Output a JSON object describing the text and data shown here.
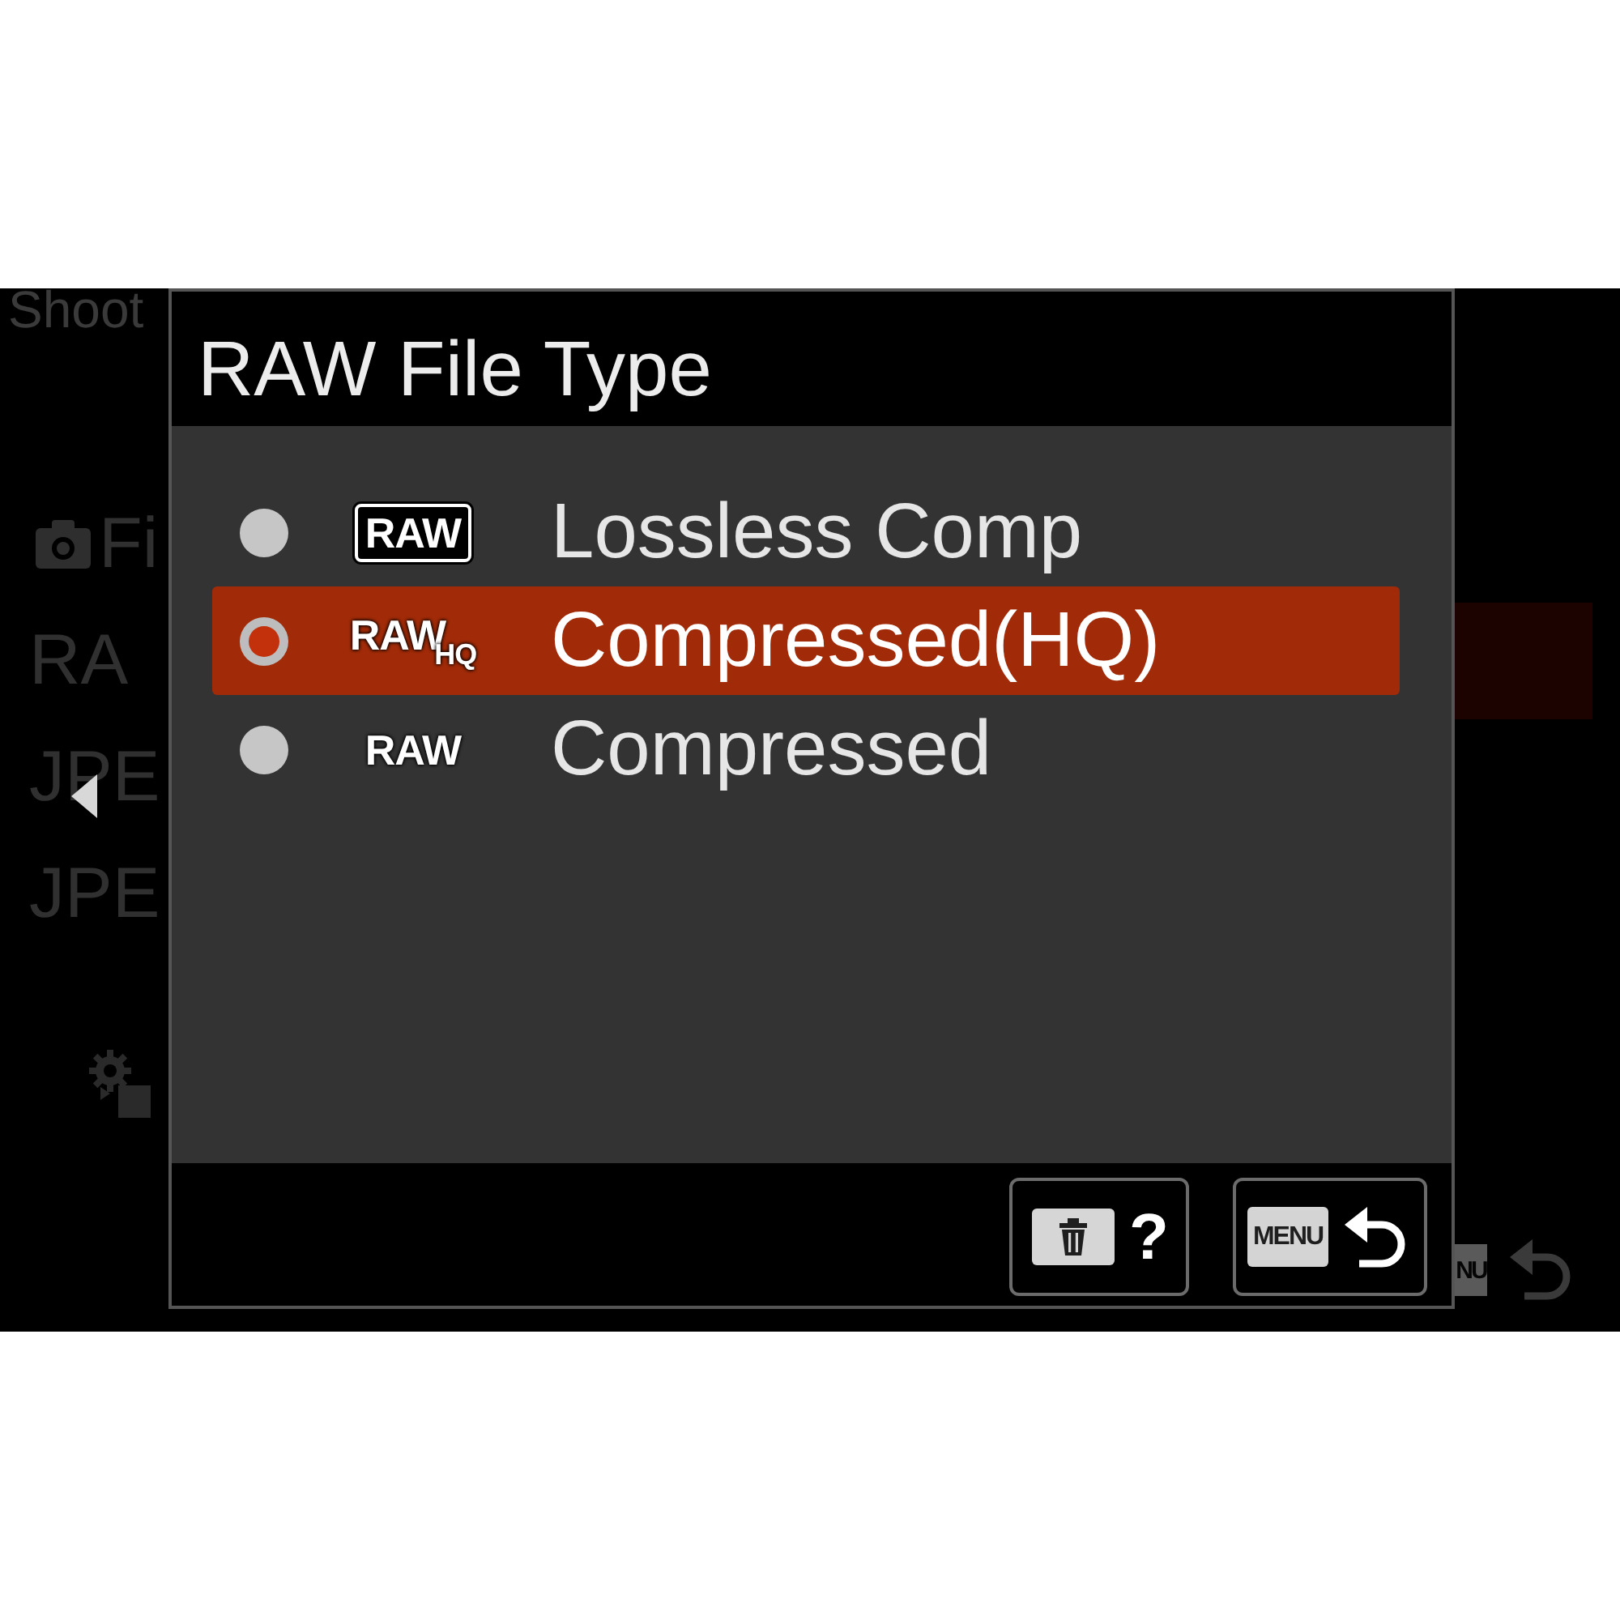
{
  "background_menu": {
    "heading": "Shoot",
    "items": [
      {
        "kind": "camera",
        "label": "Fi",
        "selected": false
      },
      {
        "kind": "text",
        "label": "RA",
        "selected": true
      },
      {
        "kind": "text",
        "label": "JPE",
        "selected": false
      },
      {
        "kind": "text",
        "label": "JPE",
        "selected": false
      }
    ],
    "back_key_label": "NU"
  },
  "dialog": {
    "title": "RAW File Type",
    "options": [
      {
        "badge": "RAW",
        "boxed": true,
        "label": "Lossless Comp",
        "selected": false
      },
      {
        "badge": "RAW$_{HQ}$",
        "boxed": false,
        "label": "Compressed(HQ)",
        "selected": true
      },
      {
        "badge": "RAW",
        "boxed": false,
        "label": "Compressed",
        "selected": false
      }
    ],
    "footer_buttons": [
      {
        "kind": "help",
        "text": "?"
      },
      {
        "kind": "back",
        "key_label": "MENU"
      }
    ]
  }
}
